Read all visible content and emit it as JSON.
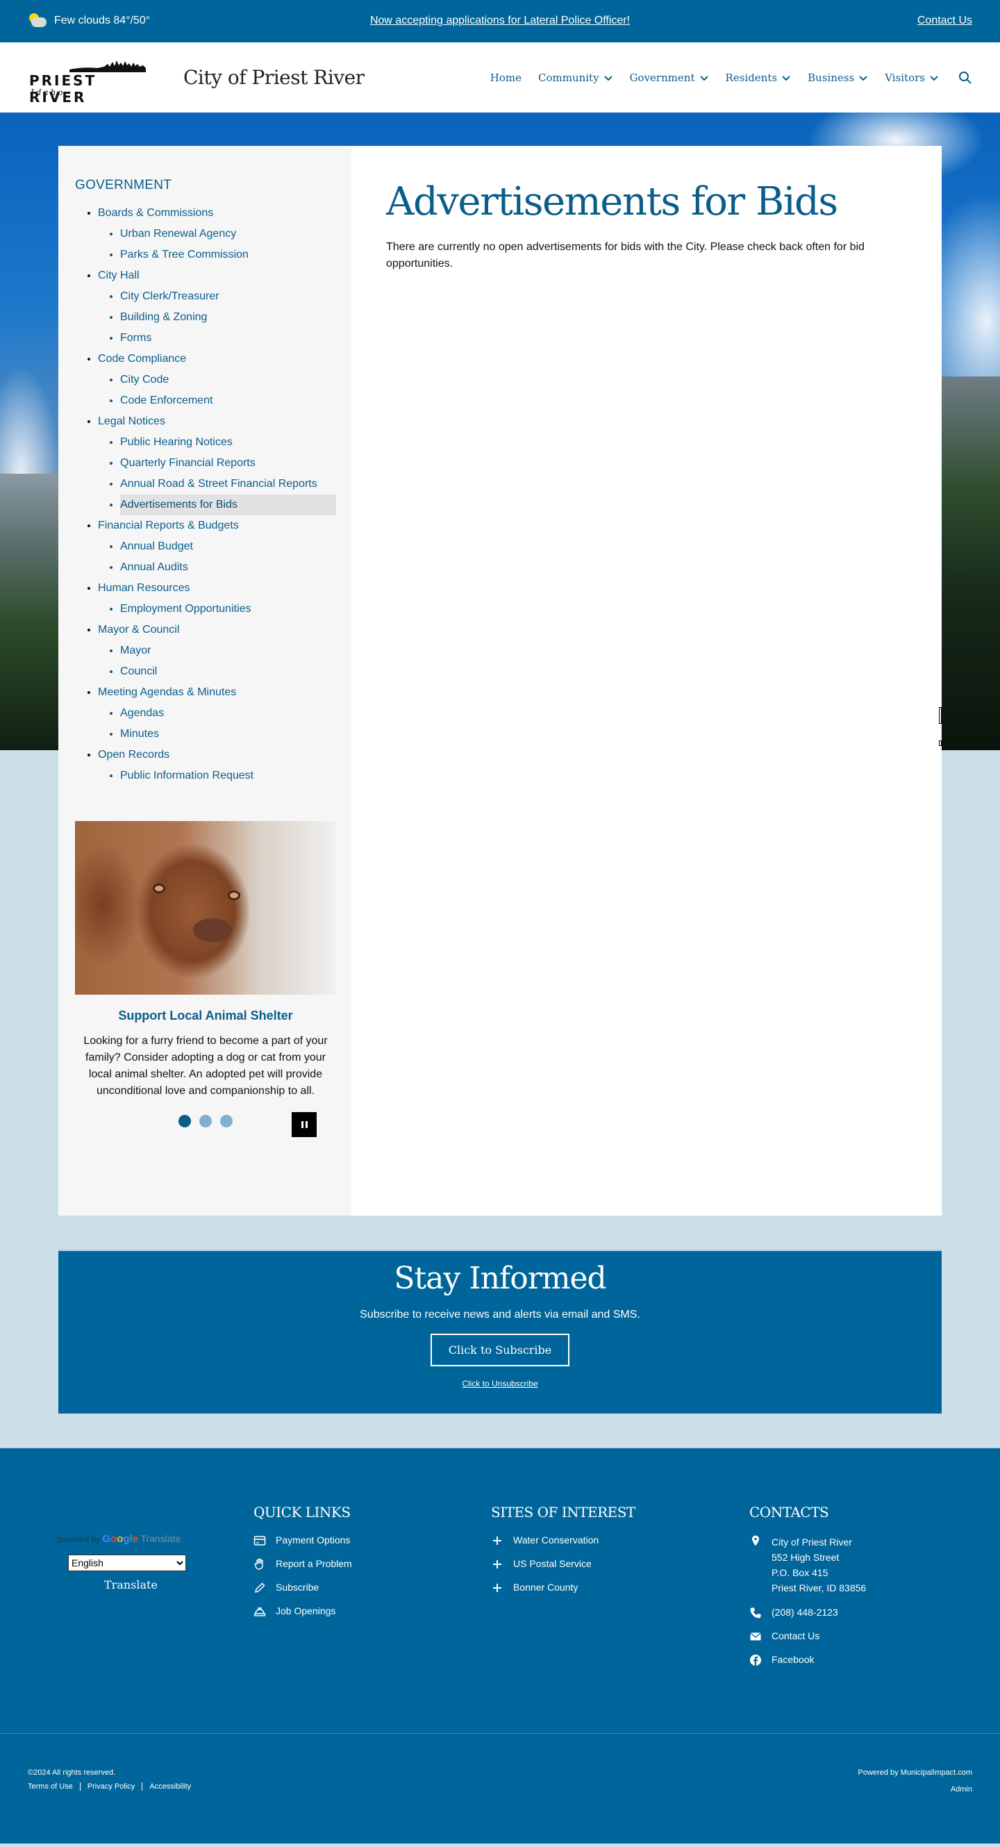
{
  "topbar": {
    "weather": "Few clouds 84°/50°",
    "alert": "Now accepting applications for Lateral Police Officer!",
    "contact": "Contact Us"
  },
  "header": {
    "logo_word": "PRIEST RIVER",
    "logo_sub": "Idaho",
    "site_title": "City of Priest River",
    "nav": [
      {
        "label": "Home",
        "dropdown": false
      },
      {
        "label": "Community",
        "dropdown": true
      },
      {
        "label": "Government",
        "dropdown": true
      },
      {
        "label": "Residents",
        "dropdown": true
      },
      {
        "label": "Business",
        "dropdown": true
      },
      {
        "label": "Visitors",
        "dropdown": true
      }
    ]
  },
  "sidebar": {
    "title": "GOVERNMENT",
    "sections": [
      {
        "label": "Boards & Commissions",
        "children": [
          "Urban Renewal Agency",
          "Parks & Tree Commission"
        ]
      },
      {
        "label": "City Hall",
        "children": [
          "City Clerk/Treasurer",
          "Building & Zoning",
          "Forms"
        ]
      },
      {
        "label": "Code Compliance",
        "children": [
          "City Code",
          "Code Enforcement"
        ]
      },
      {
        "label": "Legal Notices",
        "children": [
          "Public Hearing Notices",
          "Quarterly Financial Reports",
          "Annual Road & Street Financial Reports",
          "Advertisements for Bids"
        ]
      },
      {
        "label": "Financial Reports & Budgets",
        "children": [
          "Annual Budget",
          "Annual Audits"
        ]
      },
      {
        "label": "Human Resources",
        "children": [
          "Employment Opportunities"
        ]
      },
      {
        "label": "Mayor & Council",
        "children": [
          "Mayor",
          "Council"
        ]
      },
      {
        "label": "Meeting Agendas & Minutes",
        "children": [
          "Agendas",
          "Minutes"
        ]
      },
      {
        "label": "Open Records",
        "children": [
          "Public Information Request"
        ]
      }
    ],
    "active": "Advertisements for Bids"
  },
  "promo": {
    "title": "Support Local Animal Shelter",
    "text": "Looking for a furry friend to become a part of your family? Consider adopting a dog or cat from your local animal shelter. An adopted pet will provide unconditional love and companionship to all.",
    "slides": 3,
    "active_slide": 1
  },
  "main": {
    "title": "Advertisements for Bids",
    "body": "There are currently no open advertisements for bids with the City. Please check back often for bid opportunities."
  },
  "stay": {
    "title": "Stay Informed",
    "text": "Subscribe to receive news and alerts via email and SMS.",
    "subscribe": "Click to Subscribe",
    "unsubscribe": "Click to Unsubscribe"
  },
  "footer": {
    "translate": {
      "powered": "powered by",
      "google": "Google",
      "translate_word": "Translate",
      "language": "English",
      "button": "Translate"
    },
    "quick_links": {
      "title": "QUICK LINKS",
      "items": [
        {
          "label": "Payment Options",
          "icon": "credit-card-icon"
        },
        {
          "label": "Report a Problem",
          "icon": "hand-icon"
        },
        {
          "label": "Subscribe",
          "icon": "pencil-icon"
        },
        {
          "label": "Job Openings",
          "icon": "hard-hat-icon"
        }
      ]
    },
    "sites": {
      "title": "SITES OF INTEREST",
      "items": [
        "Water Conservation",
        "US Postal Service",
        "Bonner County"
      ]
    },
    "contacts": {
      "title": "CONTACTS",
      "address": [
        "City of Priest River",
        "552 High Street",
        "P.O. Box 415",
        "Priest River, ID 83856"
      ],
      "phone": "(208) 448-2123",
      "email": "Contact Us",
      "facebook": "Facebook"
    },
    "copyright": "©2024 All rights reserved.",
    "legal": [
      "Terms of Use",
      "Privacy Policy",
      "Accessibility"
    ],
    "powered_by": "Powered by MunicipalImpact.com",
    "admin": "Admin"
  },
  "colors": {
    "brand": "#00659a",
    "link": "#0b5d8a",
    "page_bg": "#cddfe9",
    "sidebar_bg": "#f6f6f6",
    "active_bg": "#e2e2e2"
  }
}
